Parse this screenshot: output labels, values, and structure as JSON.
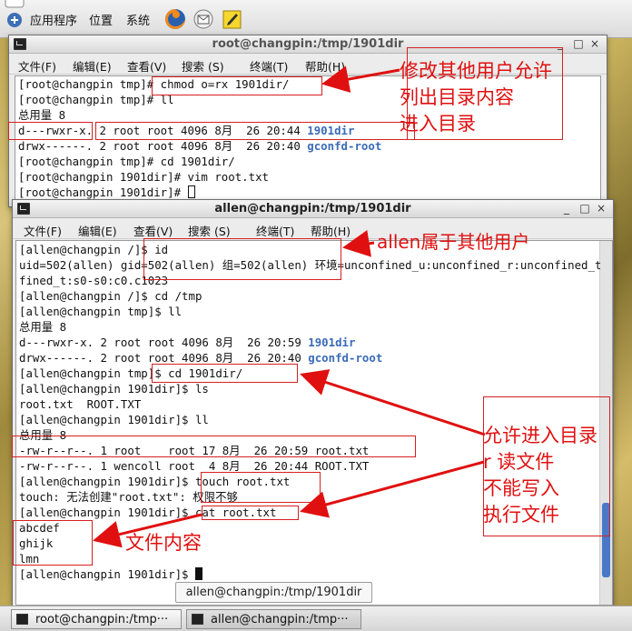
{
  "topbar": {
    "menus": [
      "应用程序",
      "位置",
      "系统"
    ],
    "icons": [
      "firefox-icon",
      "mail-icon",
      "notes-icon"
    ]
  },
  "root_window": {
    "title": "root@changpin:/tmp/1901dir",
    "controls": [
      "_",
      "□",
      "×"
    ],
    "menu": [
      "文件(F)",
      "编辑(E)",
      "查看(V)",
      "搜索 (S)",
      "终端(T)",
      "帮助(H)"
    ],
    "lines": [
      {
        "text": "[root@changpin tmp]# chmod o=rx 1901dir/"
      },
      {
        "text": "[root@changpin tmp]# ll"
      },
      {
        "text": "总用量 8"
      },
      {
        "text": "d---rwxr-x. 2 root root 4096 8月  26 20:44 ",
        "link": "1901dir"
      },
      {
        "text": "drwx------. 2 root root 4096 8月  26 20:40 ",
        "link": "gconfd-root"
      },
      {
        "text": "[root@changpin tmp]# cd 1901dir/"
      },
      {
        "text": "[root@changpin 1901dir]# vim root.txt"
      },
      {
        "text": "[root@changpin 1901dir]# ",
        "cursor": "empty"
      }
    ]
  },
  "allen_window": {
    "title": "allen@changpin:/tmp/1901dir",
    "controls": [
      "_",
      "□",
      "×"
    ],
    "menu": [
      "文件(F)",
      "编辑(E)",
      "查看(V)",
      "搜索 (S)",
      "终端(T)",
      "帮助(H)"
    ],
    "lines": [
      {
        "text": "[allen@changpin /]$ id"
      },
      {
        "text": "uid=502(allen) gid=502(allen) 组=502(allen) 环境=unconfined_u:unconfined_r:unconfined_t:s0-s0:c0.c1023"
      },
      {
        "text": "fined_t:s0-s0:c0.c1023"
      },
      {
        "text": "[allen@changpin /]$ cd /tmp"
      },
      {
        "text": "[allen@changpin tmp]$ ll"
      },
      {
        "text": "总用量 8"
      },
      {
        "text": "d---rwxr-x. 2 root root 4096 8月  26 20:59 ",
        "link": "1901dir"
      },
      {
        "text": "drwx------. 2 root root 4096 8月  26 20:40 ",
        "link": "gconfd-root"
      },
      {
        "text": "[allen@changpin tmp]$ cd 1901dir/"
      },
      {
        "text": "[allen@changpin 1901dir]$ ls"
      },
      {
        "text": "root.txt  ROOT.TXT"
      },
      {
        "text": "[allen@changpin 1901dir]$ ll"
      },
      {
        "text": "总用量 8"
      },
      {
        "text": "-rw-r--r--. 1 root    root 17 8月  26 20:59 root.txt"
      },
      {
        "text": "-rw-r--r--. 1 wencoll root  4 8月  26 20:44 ROOT.TXT"
      },
      {
        "text": "[allen@changpin 1901dir]$ touch root.txt"
      },
      {
        "text": "touch: 无法创建\"root.txt\": 权限不够"
      },
      {
        "text": "[allen@changpin 1901dir]$ cat root.txt"
      },
      {
        "text": "abcdef"
      },
      {
        "text": "ghijk"
      },
      {
        "text": "lmn"
      },
      {
        "text": "[allen@changpin 1901dir]$ ",
        "cursor": "full"
      }
    ]
  },
  "annotations": {
    "note1": "修改其他用户允许\n列出目录内容\n进入目录",
    "note2": "allen属于其他用户",
    "note3": "允许进入目录\nr 读文件\n不能写入\n执行文件",
    "note4": "文件内容",
    "color": "#e01010"
  },
  "tooltip": "allen@changpin:/tmp/1901dir",
  "taskbar": {
    "tasks": [
      "root@changpin:/tmp···",
      "allen@changpin:/tmp···"
    ]
  }
}
